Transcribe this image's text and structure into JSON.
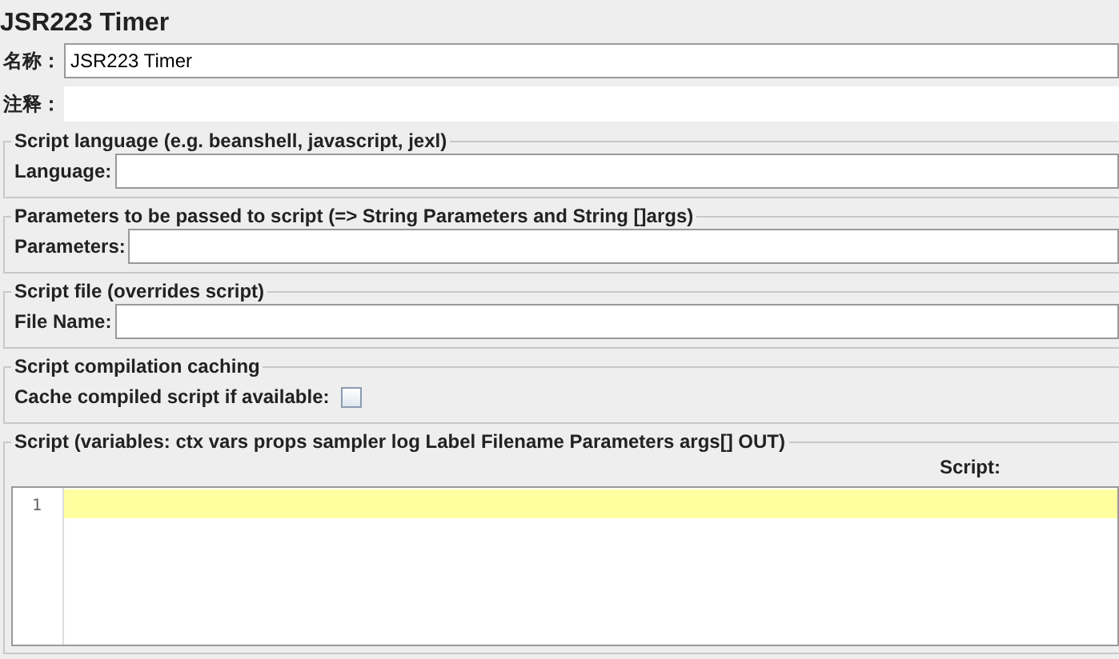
{
  "title": "JSR223 Timer",
  "name_field": {
    "label": "名称：",
    "value": "JSR223 Timer"
  },
  "comment_field": {
    "label": "注释："
  },
  "sections": [
    {
      "kind": "field",
      "legend": "Script language (e.g. beanshell, javascript, jexl)",
      "label": "Language:"
    },
    {
      "kind": "field",
      "legend": "Parameters to be passed to script (=> String Parameters and String []args)",
      "label": "Parameters:"
    },
    {
      "kind": "field",
      "legend": "Script file (overrides script)",
      "label": "File Name:"
    },
    {
      "kind": "checkbox",
      "legend": "Script compilation caching",
      "label": "Cache compiled script if available:",
      "checked": false
    },
    {
      "kind": "script",
      "legend": "Script (variables: ctx vars props sampler log Label Filename Parameters args[] OUT)",
      "label": "Script:",
      "lines": [
        "1"
      ]
    }
  ]
}
